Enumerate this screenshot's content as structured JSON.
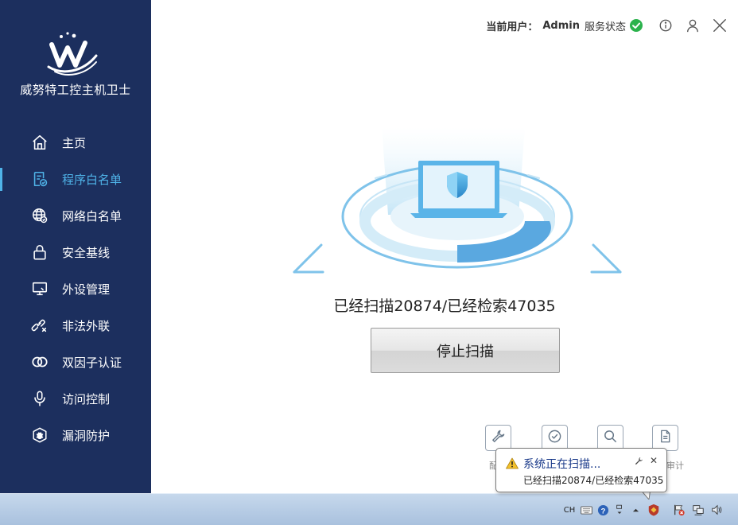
{
  "app": {
    "brand": "威努特工控主机卫士"
  },
  "nav": [
    {
      "label": "主页",
      "icon": "home-icon",
      "active": false
    },
    {
      "label": "程序白名单",
      "icon": "program-list-icon",
      "active": true
    },
    {
      "label": "网络白名单",
      "icon": "globe-icon",
      "active": false
    },
    {
      "label": "安全基线",
      "icon": "lock-icon",
      "active": false
    },
    {
      "label": "外设管理",
      "icon": "monitor-icon",
      "active": false
    },
    {
      "label": "非法外联",
      "icon": "broken-link-icon",
      "active": false
    },
    {
      "label": "双因子认证",
      "icon": "double-ring-icon",
      "active": false
    },
    {
      "label": "访问控制",
      "icon": "microphone-icon",
      "active": false
    },
    {
      "label": "漏洞防护",
      "icon": "shield-bug-icon",
      "active": false
    }
  ],
  "topbar": {
    "user_prefix": "当前用户：",
    "user_name": "Admin",
    "status_label": "服务状态"
  },
  "scan": {
    "progress_text": "已经扫描20874/已经检索47035",
    "scanned": 20874,
    "retrieved": 47035,
    "stop_label": "停止扫描"
  },
  "tools": [
    {
      "icon": "wrench-icon",
      "label": "配"
    },
    {
      "icon": "check-circle-icon",
      "label": ""
    },
    {
      "icon": "magnifier-icon",
      "label": ""
    },
    {
      "icon": "document-icon",
      "label": "审计"
    }
  ],
  "notification": {
    "title": "系统正在扫描...",
    "body": "已经扫描20874/已经检索47035"
  },
  "taskbar": {
    "language": "CH"
  },
  "colors": {
    "sidebar_bg": "#1c2f5e",
    "accent": "#4fb3e8",
    "status_ok": "#2bb24c"
  }
}
